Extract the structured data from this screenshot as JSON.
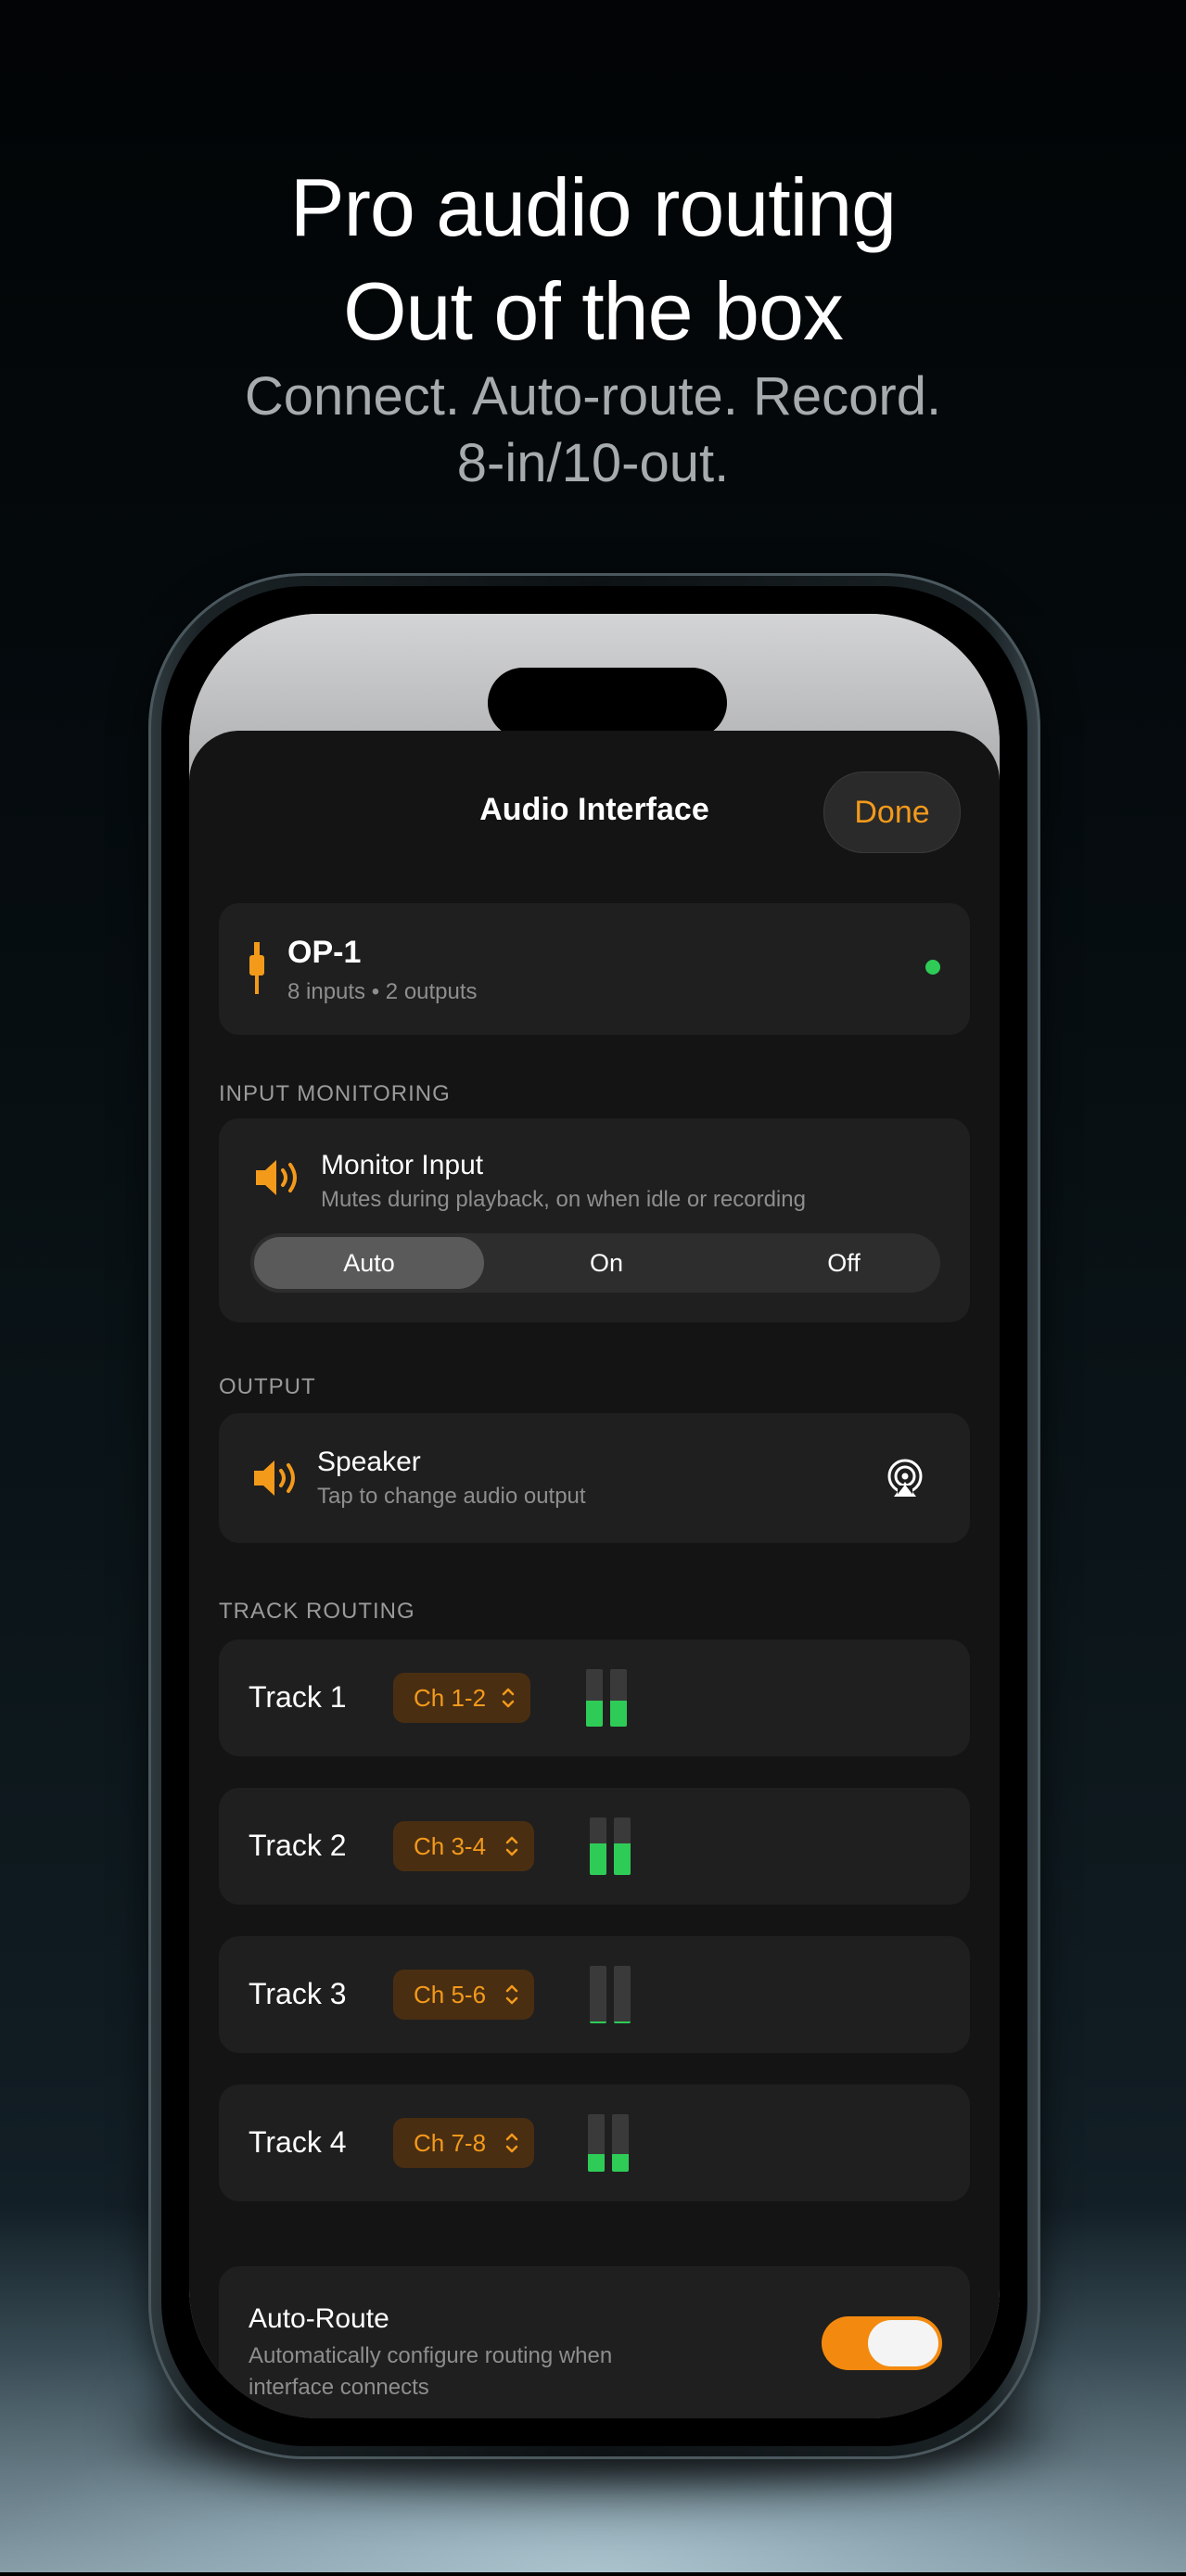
{
  "marketing": {
    "headline_line1": "Pro audio routing",
    "headline_line2": "Out of the box",
    "subtitle_line1": "Connect. Auto-route. Record.",
    "subtitle_line2": "8-in/10-out."
  },
  "sheet": {
    "title": "Audio Interface",
    "done_label": "Done"
  },
  "device": {
    "name": "OP-1",
    "details": "8 inputs • 2 outputs",
    "icon": "plug-icon",
    "connected": true,
    "status_color": "#2ECC57"
  },
  "input_monitoring": {
    "section_label": "INPUT MONITORING",
    "title": "Monitor Input",
    "subtitle": "Mutes during playback, on when idle or recording",
    "icon": "speaker-icon",
    "options": [
      "Auto",
      "On",
      "Off"
    ],
    "selected": "Auto"
  },
  "output": {
    "section_label": "OUTPUT",
    "title": "Speaker",
    "subtitle": "Tap to change audio output",
    "icon": "speaker-icon",
    "action_icon": "airplay-icon"
  },
  "track_routing": {
    "section_label": "TRACK ROUTING",
    "tracks": [
      {
        "name": "Track 1",
        "channel": "Ch 1-2",
        "level_left": 0.45,
        "level_right": 0.45
      },
      {
        "name": "Track 2",
        "channel": "Ch 3-4",
        "level_left": 0.55,
        "level_right": 0.55
      },
      {
        "name": "Track 3",
        "channel": "Ch 5-6",
        "level_left": 0.03,
        "level_right": 0.03
      },
      {
        "name": "Track 4",
        "channel": "Ch 7-8",
        "level_left": 0.3,
        "level_right": 0.3
      }
    ]
  },
  "auto_route": {
    "title": "Auto-Route",
    "subtitle": "Automatically configure routing when interface connects",
    "enabled": true
  },
  "colors": {
    "accent": "#F39A1B",
    "meter_green": "#2ECC57",
    "background": "#141414",
    "card": "#1F1F1F"
  }
}
